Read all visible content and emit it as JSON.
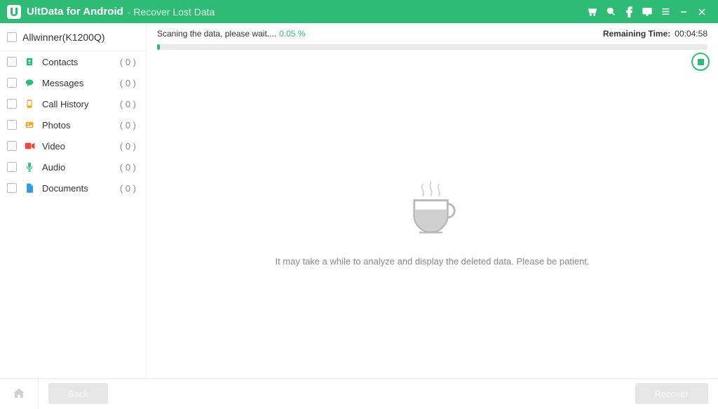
{
  "titlebar": {
    "app_name": "UltData for Android",
    "subtitle": "- Recover Lost Data"
  },
  "sidebar": {
    "device_name": "Allwinner(K1200Q)",
    "categories": [
      {
        "label": "Contacts",
        "count": "( 0 )",
        "icon_color": "#2fbb76",
        "icon": "contacts"
      },
      {
        "label": "Messages",
        "count": "( 0 )",
        "icon_color": "#2fbb76",
        "icon": "messages"
      },
      {
        "label": "Call History",
        "count": "( 0 )",
        "icon_color": "#f5a623",
        "icon": "callhistory"
      },
      {
        "label": "Photos",
        "count": "( 0 )",
        "icon_color": "#f5a623",
        "icon": "photos"
      },
      {
        "label": "Video",
        "count": "( 0 )",
        "icon_color": "#e74c3c",
        "icon": "video"
      },
      {
        "label": "Audio",
        "count": "( 0 )",
        "icon_color": "#2fbb76",
        "icon": "audio"
      },
      {
        "label": "Documents",
        "count": "( 0 )",
        "icon_color": "#3498db",
        "icon": "documents"
      }
    ]
  },
  "main": {
    "status_text": "Scaning the data, please wait....",
    "status_pct": "0.05 %",
    "remaining_label": "Remaining Time:",
    "remaining_value": "00:04:58",
    "wait_text": "It may take a while to analyze and display the deleted data. Please be patient."
  },
  "footer": {
    "back_label": "Back",
    "recover_label": "Recover"
  }
}
